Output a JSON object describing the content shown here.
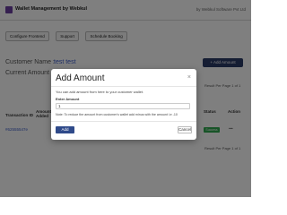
{
  "header": {
    "app_title": "Wallet Management by Webkul",
    "vendor": "by Webkul Software Pvt Ltd"
  },
  "toolbar": {
    "buttons": [
      "Configure Frontend",
      "Support",
      "Schedule Booking"
    ]
  },
  "page": {
    "customer_name_label": "Customer Name :",
    "customer_name_value": "test test",
    "current_amount_label": "Current Amount",
    "add_button_bg": "+ Add Amount",
    "col_transaction_id": "Transaction ID",
    "col_amount": "Amount",
    "col_amount2": "Added",
    "col_status": "Status",
    "col_action": "Action",
    "row_id": "#62555547e",
    "row_status": "Success",
    "row_action": "•••",
    "pager_top": "Result Per Page 1 of 1",
    "pager_bottom": "Result Per Page 1 of 1"
  },
  "modal": {
    "title": "Add Amount",
    "close_glyph": "×",
    "description": "You can add amount from here to your customer wallet.",
    "field_label": "Enter Amount",
    "input_value": "1",
    "note": "Note: To reduce the amount from customer's wallet add minus with the amount i.e -10",
    "add_label": "Add",
    "cancel_label": "Cancel"
  },
  "colors": {
    "brand": "#6b3fa0",
    "primary_button": "#2f4a8a",
    "success": "#2fa84f",
    "link": "#3b5bc9"
  }
}
